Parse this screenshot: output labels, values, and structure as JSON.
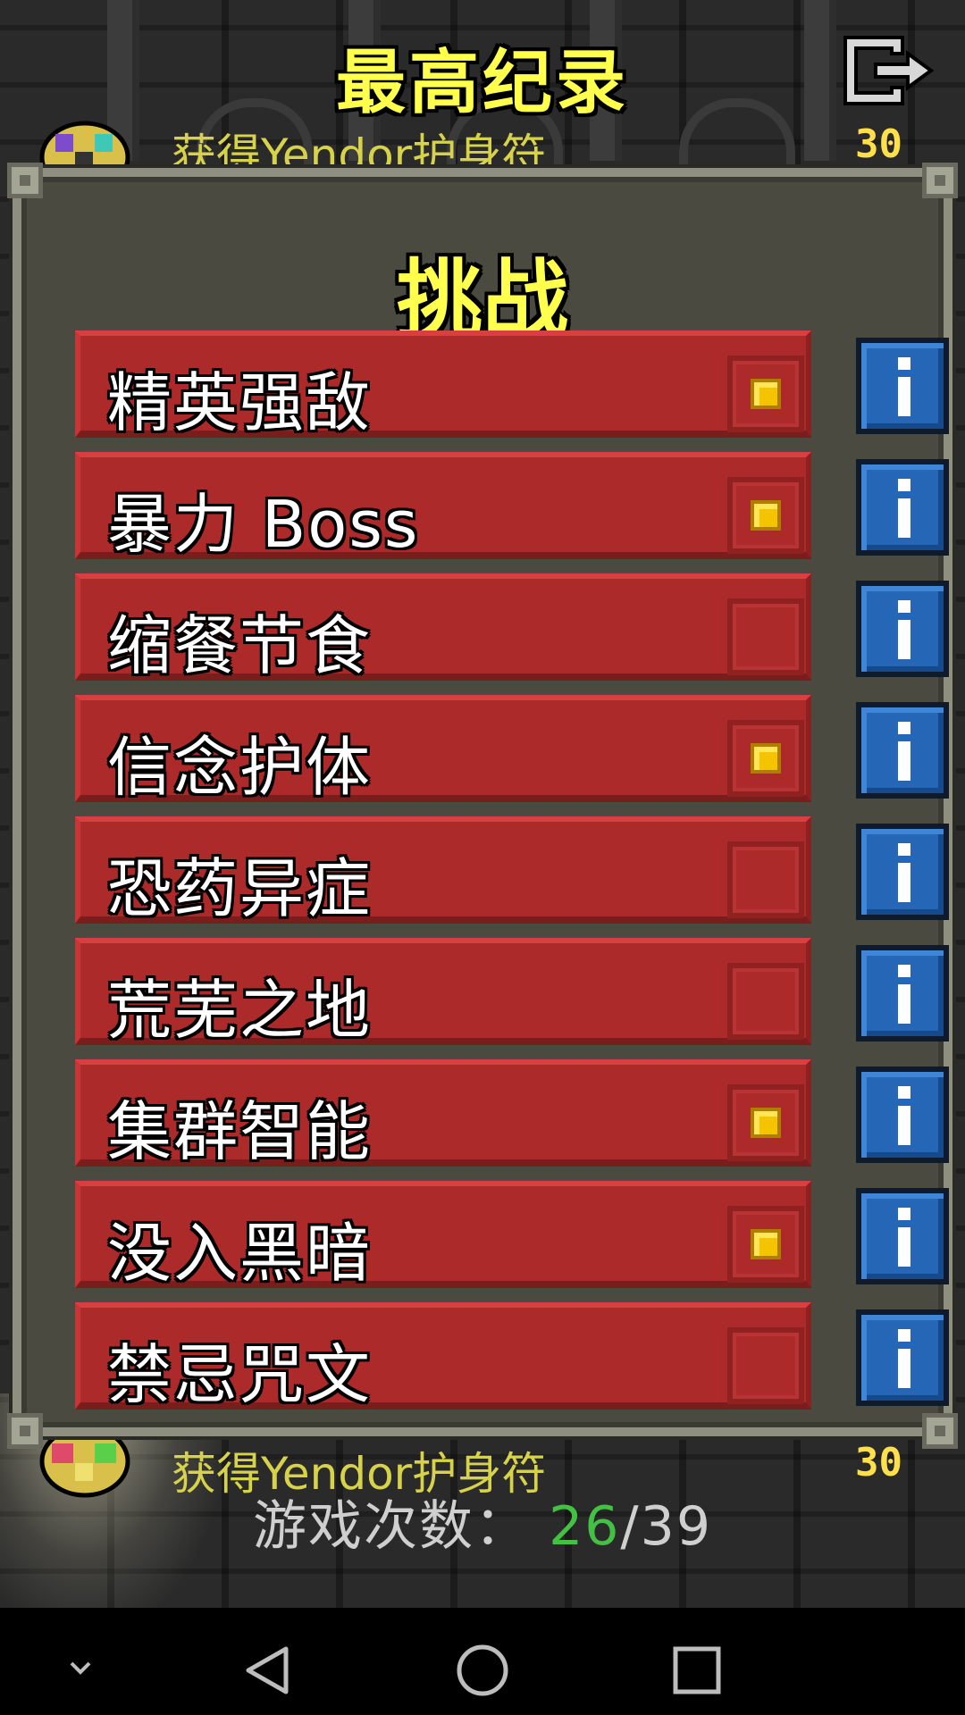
{
  "header": {
    "title": "最高纪录",
    "exit_icon": "exit-door-icon"
  },
  "records": [
    {
      "text": "获得Yendor护身符",
      "level": "30",
      "icon": "amulet-gem-icon"
    },
    {
      "text": "获得Yendor护身符",
      "level": "30",
      "icon": "amulet-gem-icon"
    }
  ],
  "dialog": {
    "title": "挑战",
    "challenges": [
      {
        "label": "精英强敌",
        "checked": true
      },
      {
        "label": "暴力 Boss",
        "checked": true
      },
      {
        "label": "缩餐节食",
        "checked": false
      },
      {
        "label": "信念护体",
        "checked": true
      },
      {
        "label": "恐药异症",
        "checked": false
      },
      {
        "label": "荒芜之地",
        "checked": false
      },
      {
        "label": "集群智能",
        "checked": true
      },
      {
        "label": "没入黑暗",
        "checked": true
      },
      {
        "label": "禁忌咒文",
        "checked": false
      }
    ],
    "info_icon": "info-icon"
  },
  "games": {
    "label": "游戏次数：",
    "played": "26",
    "separator": "/",
    "total": "39"
  },
  "navigation": {
    "items": [
      "chevron-down-icon",
      "back-triangle-icon",
      "home-circle-icon",
      "recents-square-icon"
    ]
  },
  "colors": {
    "title_yellow": "#ffff4d",
    "challenge_red": "#ad2a2a",
    "info_blue": "#2567b6",
    "checked_yellow": "#f4c400",
    "played_green": "#44c044"
  }
}
